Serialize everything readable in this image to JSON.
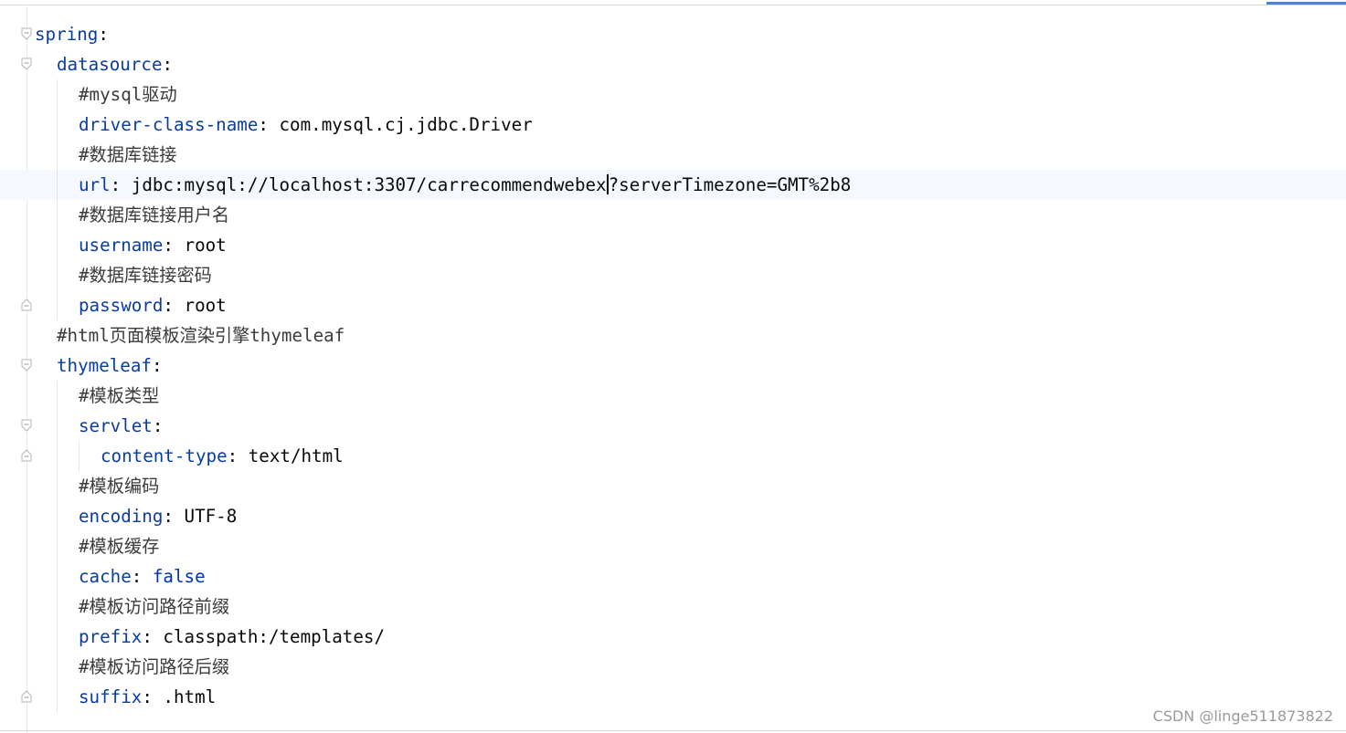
{
  "editor": {
    "lines": [
      {
        "key": "spring",
        "sep": ":",
        "value": ""
      },
      {
        "key": "datasource",
        "sep": ":",
        "value": ""
      },
      {
        "comment": "#mysql驱动"
      },
      {
        "key": "driver-class-name",
        "sep": ": ",
        "value": "com.mysql.cj.jdbc.Driver"
      },
      {
        "comment": "#数据库链接"
      },
      {
        "key": "url",
        "sep": ": ",
        "value_before_caret": "jdbc:mysql://localhost:3307/carrecommendwebex",
        "value_after_caret": "?serverTimezone=GMT%2b8"
      },
      {
        "comment": "#数据库链接用户名"
      },
      {
        "key": "username",
        "sep": ": ",
        "value": "root"
      },
      {
        "comment": "#数据库链接密码"
      },
      {
        "key": "password",
        "sep": ": ",
        "value": "root"
      },
      {
        "comment": "#html页面模板渲染引擎thymeleaf"
      },
      {
        "key": "thymeleaf",
        "sep": ":",
        "value": ""
      },
      {
        "comment": "#模板类型"
      },
      {
        "key": "servlet",
        "sep": ":",
        "value": ""
      },
      {
        "key": "content-type",
        "sep": ": ",
        "value": "text/html"
      },
      {
        "comment": "#模板编码"
      },
      {
        "key": "encoding",
        "sep": ": ",
        "value": "UTF-8"
      },
      {
        "comment": "#模板缓存"
      },
      {
        "key": "cache",
        "sep": ": ",
        "value": "false"
      },
      {
        "comment": "#模板访问路径前缀"
      },
      {
        "key": "prefix",
        "sep": ": ",
        "value": "classpath:/templates/"
      },
      {
        "comment": "#模板访问路径后缀"
      },
      {
        "key": "suffix",
        "sep": ": ",
        "value": ".html"
      }
    ]
  },
  "watermark": "CSDN @linge511873822",
  "colors": {
    "key": "#0a3d9e",
    "keyword": "#0033b3",
    "text": "#080808",
    "current_line": "#f5f8fe",
    "accent": "#4a86c8"
  },
  "icons": {
    "fold_open": "fold-open-icon",
    "fold_end": "fold-end-icon"
  }
}
